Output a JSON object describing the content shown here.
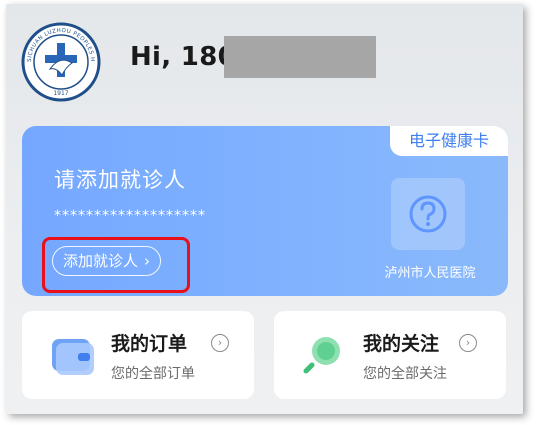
{
  "header": {
    "greeting": "Hi, 180",
    "logo_text_top": "SICHUAN LUZHOU PEOPLES HOSPITAL",
    "logo_year": "1917",
    "logo_icon": "hospital-logo"
  },
  "health_card": {
    "tag": "电子健康卡",
    "title": "请添加就诊人",
    "masked_id": "*******************",
    "add_button": "添加就诊人",
    "qr_icon": "question-icon",
    "hospital_name": "泸州市人民医院",
    "colors": {
      "gradient_start": "#75a7ff",
      "gradient_end": "#8ab9fb",
      "tag_text": "#3f7ff0",
      "highlight": "#e8101a"
    }
  },
  "tiles": [
    {
      "title": "我的订单",
      "subtitle": "您的全部订单",
      "icon": "wallet-icon"
    },
    {
      "title": "我的关注",
      "subtitle": "您的全部关注",
      "icon": "search-icon"
    }
  ]
}
